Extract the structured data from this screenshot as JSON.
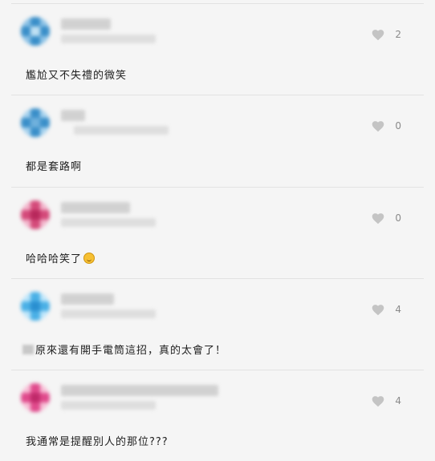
{
  "comments": [
    {
      "text": "尷尬又不失禮的微笑",
      "likes": "2",
      "avatar_color": "#3a8fc9"
    },
    {
      "text": "都是套路啊",
      "likes": "0",
      "avatar_color": "#3a8fc9"
    },
    {
      "text": "哈哈哈笑了",
      "likes": "0",
      "avatar_color": "#d44a7a",
      "emoji_icon": "rolling-on-floor-laughing-icon"
    },
    {
      "text": "原來還有開手電筒這招，真的太會了！",
      "likes": "4",
      "avatar_color": "#4ab0e6"
    },
    {
      "text": "我通常是提醒別人的那位???",
      "likes": "4",
      "avatar_color": "#e04a8c"
    }
  ]
}
